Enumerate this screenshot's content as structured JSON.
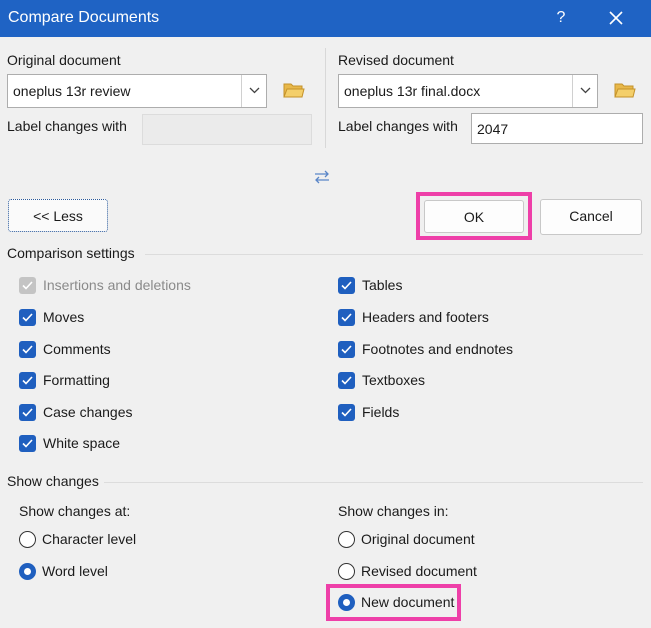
{
  "window": {
    "title": "Compare Documents",
    "help_label": "?"
  },
  "original": {
    "label": "Original document",
    "value": "oneplus 13r review",
    "label_changes_label": "Label changes with",
    "label_changes_value": ""
  },
  "revised": {
    "label": "Revised document",
    "value": "oneplus 13r final.docx",
    "label_changes_label": "Label changes with",
    "label_changes_value": "2047"
  },
  "buttons": {
    "less": "<< Less",
    "ok": "OK",
    "cancel": "Cancel"
  },
  "comparison": {
    "heading": "Comparison settings",
    "left": [
      {
        "label": "Insertions and deletions",
        "checked": true,
        "disabled": true
      },
      {
        "label": "Moves",
        "checked": true
      },
      {
        "label": "Comments",
        "checked": true
      },
      {
        "label": "Formatting",
        "checked": true
      },
      {
        "label": "Case changes",
        "checked": true
      },
      {
        "label": "White space",
        "checked": true
      }
    ],
    "right": [
      {
        "label": "Tables",
        "checked": true
      },
      {
        "label": "Headers and footers",
        "checked": true
      },
      {
        "label": "Footnotes and endnotes",
        "checked": true
      },
      {
        "label": "Textboxes",
        "checked": true
      },
      {
        "label": "Fields",
        "checked": true
      }
    ]
  },
  "show_changes": {
    "heading": "Show changes",
    "at_label": "Show changes at:",
    "at_options": [
      {
        "label": "Character level",
        "selected": false
      },
      {
        "label": "Word level",
        "selected": true
      }
    ],
    "in_label": "Show changes in:",
    "in_options": [
      {
        "label": "Original document",
        "selected": false
      },
      {
        "label": "Revised document",
        "selected": false
      },
      {
        "label": "New document",
        "selected": true
      }
    ]
  },
  "colors": {
    "titlebar": "#1f63c4",
    "accent": "#1f5fbf",
    "highlight": "#ee3fa8"
  }
}
